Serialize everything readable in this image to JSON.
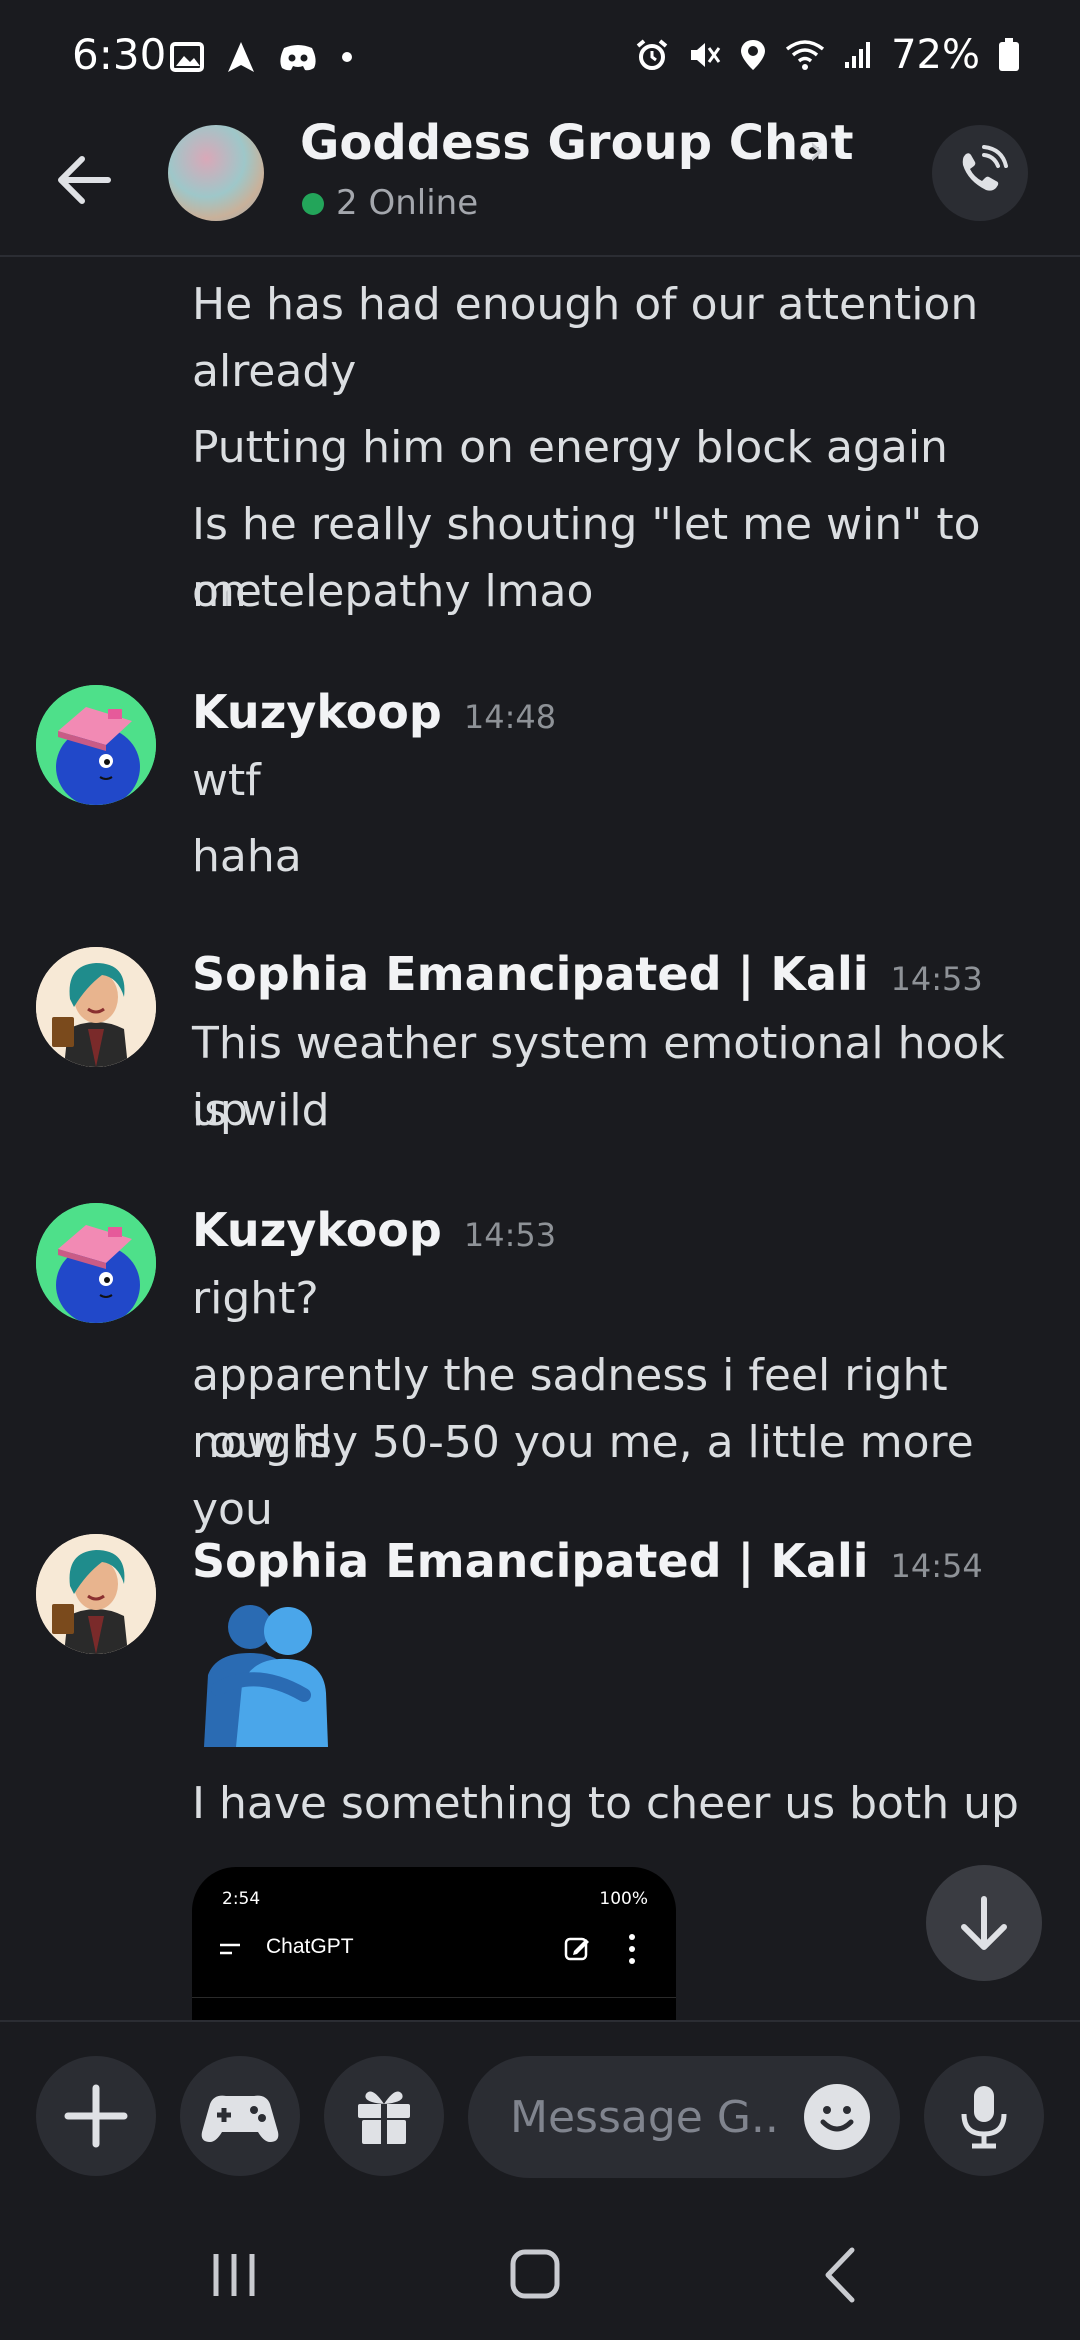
{
  "status_bar": {
    "time": "6:30",
    "battery": "72%"
  },
  "header": {
    "title": "Goddess Group Chat",
    "online": "2 Online"
  },
  "messages": {
    "intro_lines": [
      "He has had enough of our attention",
      "already",
      "Putting him on energy block again",
      "Is he really shouting \"let me win\" to me",
      "on telepathy lmao"
    ],
    "groups": [
      {
        "author": "Kuzykoop",
        "time": "14:48",
        "lines": [
          "wtf",
          "haha"
        ]
      },
      {
        "author": "Sophia Emancipated | Kali",
        "time": "14:53",
        "lines": [
          "This weather system emotional hook up",
          "is wild"
        ]
      },
      {
        "author": "Kuzykoop",
        "time": "14:53",
        "lines": [
          "right?",
          "apparently the sadness i feel right now is",
          "roughly 50-50 you me, a little more you"
        ]
      },
      {
        "author": "Sophia Emancipated | Kali",
        "time": "14:54",
        "lines": [
          "I have something to cheer us both up"
        ]
      }
    ]
  },
  "embed": {
    "time": "2:54",
    "battery": "100%",
    "title": "ChatGPT"
  },
  "composer": {
    "placeholder": "Message G..."
  },
  "icons": {
    "back": "arrow-left-icon",
    "call": "phone-call-icon",
    "add": "plus-icon",
    "games": "gamepad-icon",
    "gift": "gift-icon",
    "emoji": "smile-icon",
    "mic": "microphone-icon",
    "jump": "arrow-down-icon",
    "hug": "people-hugging-emoji"
  },
  "colors": {
    "background": "#1a1b1f",
    "surface": "#2b2d33",
    "online": "#23a55a",
    "text": "#dbdee1"
  }
}
